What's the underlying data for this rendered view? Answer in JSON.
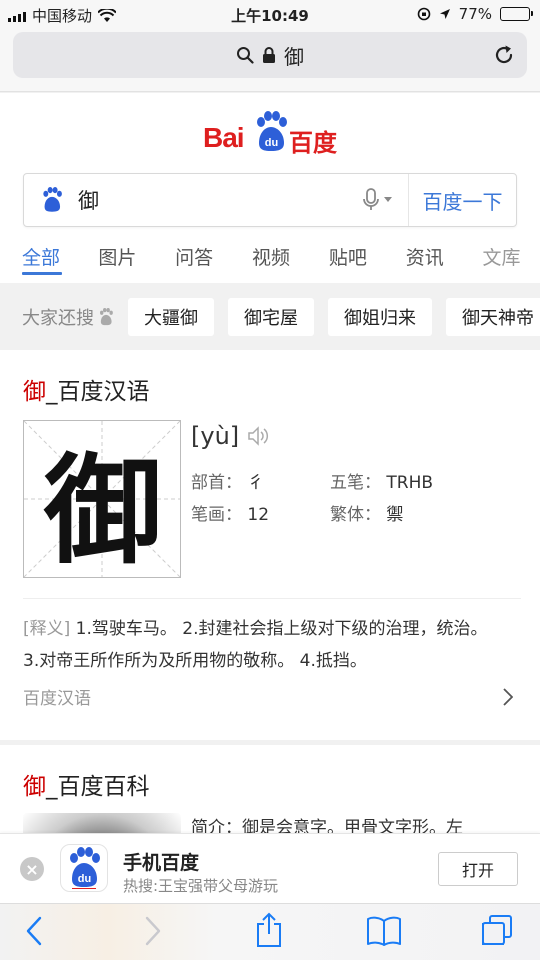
{
  "status_bar": {
    "carrier": "中国移动",
    "time": "上午10:49",
    "battery_text": "77%",
    "battery_level": 0.77
  },
  "url_bar": {
    "query": "御"
  },
  "logo": {
    "text_latin": "Bai",
    "badge": "du",
    "text_cn": "百度"
  },
  "search": {
    "query": "御",
    "button_label": "百度一下"
  },
  "tabs": [
    "全部",
    "图片",
    "问答",
    "视频",
    "贴吧",
    "资讯",
    "文库"
  ],
  "also_search": {
    "label": "大家还搜",
    "chips": [
      "大疆御",
      "御宅屋",
      "御姐归来",
      "御天神帝"
    ]
  },
  "hanyu_card": {
    "title_char": "御",
    "title_rest": "_百度汉语",
    "character": "御",
    "pinyin": "[yù]",
    "radical_label": "部首：",
    "radical": "彳",
    "wubi_label": "五笔：",
    "wubi": "TRHB",
    "strokes_label": "笔画：",
    "strokes": "12",
    "traditional_label": "繁体：",
    "traditional": "禦",
    "def_tag": "[释义]",
    "def_line1": "1.驾驶车马。 2.封建社会指上级对下级的治理，统治。",
    "def_line2": "3.对帝王所作所为及所用物的敬称。 4.抵挡。",
    "source": "百度汉语"
  },
  "baike_card": {
    "title_char": "御",
    "title_rest": "_百度百科",
    "intro": "简介：御是会意字。甲骨文字形。左"
  },
  "app_banner": {
    "name": "手机百度",
    "hot": "热搜:王宝强带父母游玩",
    "open_label": "打开"
  },
  "colors": {
    "baidu_red": "#de1f1f",
    "baidu_blue": "#2d5fd8",
    "link_blue": "#3c78d8",
    "ios_blue": "#1a7cf5"
  }
}
